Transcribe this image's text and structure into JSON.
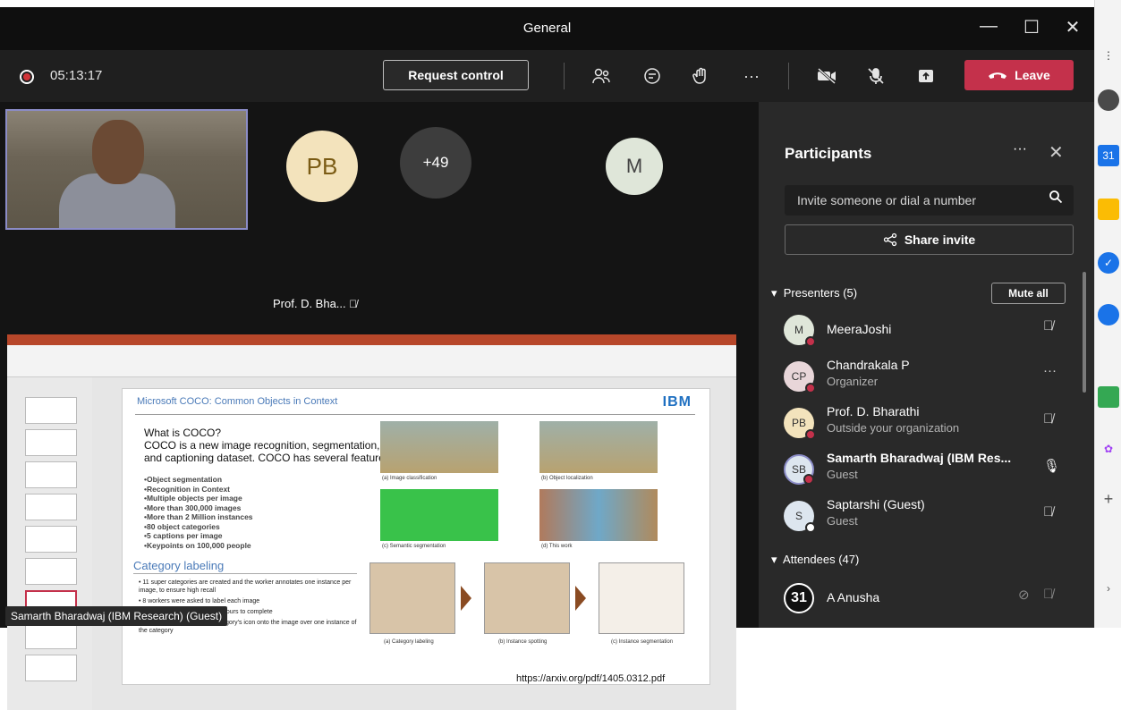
{
  "window": {
    "title": "General",
    "minimize": "—",
    "maximize": "☐",
    "close": "✕"
  },
  "toolbar": {
    "timer": "05:13:17",
    "request_control": "Request control",
    "more": "···",
    "leave": "Leave",
    "icons": [
      "people-icon",
      "chat-icon",
      "raise-hand-icon",
      "more-icon",
      "camera-off-icon",
      "mic-off-icon",
      "share-tray-icon"
    ]
  },
  "stage": {
    "tiles": [
      {
        "initials": "PB",
        "name": "Prof. D. Bha...",
        "color": "#f3e3bc"
      },
      {
        "initials": "+49",
        "color": "#3d3d3d"
      },
      {
        "initials": "M",
        "color": "#dfe6d9"
      }
    ],
    "presenter_label": "Samarth Bharadwaj (IBM Research) (Guest)"
  },
  "slide": {
    "header": "Microsoft COCO: Common Objects in Context",
    "logo": "IBM",
    "intro_lines": [
      "What is COCO?",
      "COCO is a new image recognition, segmentation, and captioning dataset. COCO has several features:"
    ],
    "features": [
      "•Object segmentation",
      "•Recognition in Context",
      "•Multiple objects per image",
      "•More than 300,000 images",
      "•More than 2 Million instances",
      "•80 object categories",
      "•5 captions per image",
      "•Keypoints on 100,000 people"
    ],
    "category_title": "Category labeling",
    "category_bullets": [
      "• 11 super categories are created and the worker annotates one instance per image, to ensure high recall",
      "• 8 workers were asked to label each image",
      "• This stage took ~20k worker hours to complete",
      "• the worker must drag the category's icon onto the image over one instance of the category"
    ],
    "captions": [
      "(a) Image classification",
      "(b) Object localization",
      "(c) Semantic segmentation",
      "(d) This work",
      "(a) Category labeling",
      "(b) Instance spotting",
      "(c) Instance segmentation"
    ],
    "url": "https://arxiv.org/pdf/1405.0312.pdf"
  },
  "panel": {
    "title": "Participants",
    "more": "···",
    "close": "✕",
    "invite_placeholder": "Invite someone or dial a number",
    "share_invite": "Share invite",
    "presenters_header": "Presenters (5)",
    "mute_all": "Mute all",
    "presenters": [
      {
        "initials": "M",
        "name": "MeeraJoshi",
        "role": "",
        "color": "#dfe6d9",
        "icon": "mic-off-icon"
      },
      {
        "initials": "CP",
        "name": "Chandrakala P",
        "role": "Organizer",
        "color": "#e8d6d9",
        "icon": "more-icon"
      },
      {
        "initials": "PB",
        "name": "Prof. D. Bharathi",
        "role": "Outside your organization",
        "color": "#f3e3bc",
        "icon": "mic-off-icon"
      },
      {
        "initials": "SB",
        "name": "Samarth Bharadwaj (IBM Res...",
        "role": "Guest",
        "color": "#dde6ef",
        "icon": "mic-on-icon"
      },
      {
        "initials": "S",
        "name": "Saptarshi (Guest)",
        "role": "Guest",
        "color": "#dde6ef",
        "icon": "mic-off-icon"
      }
    ],
    "attendees_header": "Attendees (47)",
    "attendees": [
      {
        "initials": "31",
        "name": "A Anusha",
        "role": "",
        "color": "#111111"
      }
    ]
  }
}
